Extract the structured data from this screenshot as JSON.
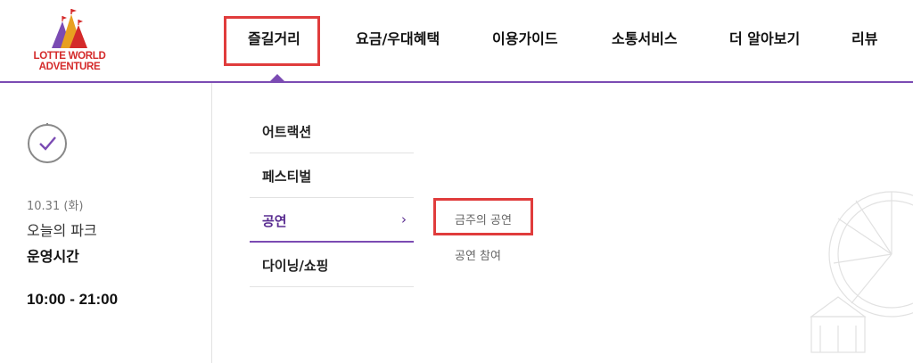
{
  "logo": {
    "line1": "LOTTE WORLD",
    "line2": "ADVENTURE"
  },
  "gnb": [
    {
      "label": "즐길거리",
      "active": true
    },
    {
      "label": "요금/우대혜택"
    },
    {
      "label": "이용가이드"
    },
    {
      "label": "소통서비스"
    },
    {
      "label": "더 알아보기"
    },
    {
      "label": "리뷰"
    }
  ],
  "info": {
    "date": "10.31 (화)",
    "park_today": "오늘의 파크",
    "hours_label": "운영시간",
    "hours": "10:00 - 21:00"
  },
  "submenu": [
    {
      "label": "어트랙션"
    },
    {
      "label": "페스티벌"
    },
    {
      "label": "공연",
      "active": true,
      "arrow": "›"
    },
    {
      "label": "다이닝/쇼핑"
    }
  ],
  "third_menu": [
    {
      "label": "금주의 공연",
      "highlighted": true
    },
    {
      "label": "공연 참여"
    }
  ],
  "colors": {
    "accent": "#7b4bb3",
    "highlight": "#e03c3c",
    "brand_red": "#d42a2a"
  }
}
